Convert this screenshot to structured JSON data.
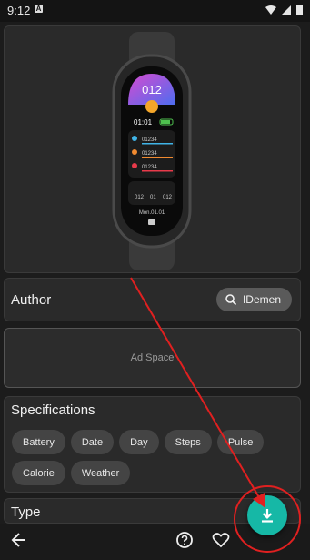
{
  "status_bar": {
    "time": "9:12"
  },
  "watch_face": {
    "big_number": "012",
    "time": "01:01",
    "rows": [
      "01234",
      "01234",
      "01234"
    ],
    "bottom_values": [
      "012",
      "01",
      "012"
    ],
    "date": "Mon.01.01"
  },
  "author": {
    "label": "Author",
    "name": "IDemen"
  },
  "ad": {
    "text": "Ad Space"
  },
  "specifications": {
    "title": "Specifications",
    "chips": [
      "Battery",
      "Date",
      "Day",
      "Steps",
      "Pulse",
      "Calorie",
      "Weather"
    ]
  },
  "type_section": {
    "title": "Type"
  },
  "colors": {
    "accent": "#16b8a6",
    "annotation": "#e02020"
  }
}
